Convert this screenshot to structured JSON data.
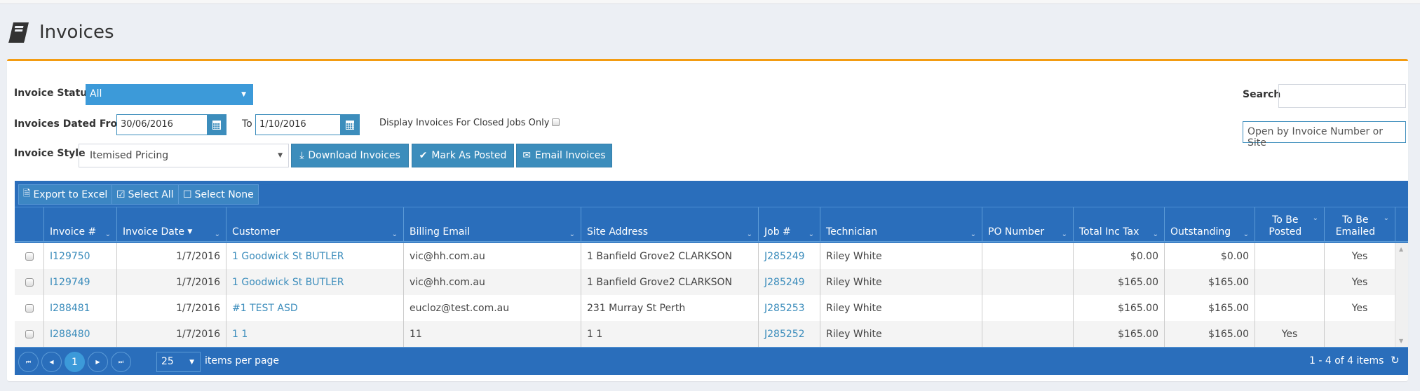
{
  "page": {
    "title": "Invoices",
    "icon": "book-icon"
  },
  "filters": {
    "status_label": "Invoice Status",
    "status_value": "All",
    "dated_from_label": "Invoices Dated From",
    "date_from": "30/06/2016",
    "to_label": "To",
    "date_to": "1/10/2016",
    "closed_jobs_label": "Display Invoices For Closed Jobs Only",
    "style_label": "Invoice Style",
    "style_value": "Itemised Pricing",
    "search_label": "Search",
    "search_value": "",
    "open_placeholder": "Open by Invoice Number or Site"
  },
  "actions": {
    "download": "Download Invoices",
    "mark_posted": "Mark As Posted",
    "email": "Email Invoices"
  },
  "grid_toolbar": {
    "export": "Export to Excel",
    "select_all": "Select All",
    "select_none": "Select None"
  },
  "columns": [
    {
      "key": "invoice",
      "label": "Invoice #"
    },
    {
      "key": "date",
      "label": "Invoice Date",
      "sorted": "desc"
    },
    {
      "key": "customer",
      "label": "Customer"
    },
    {
      "key": "email",
      "label": "Billing Email"
    },
    {
      "key": "site",
      "label": "Site Address"
    },
    {
      "key": "job",
      "label": "Job #"
    },
    {
      "key": "tech",
      "label": "Technician"
    },
    {
      "key": "po",
      "label": "PO Number"
    },
    {
      "key": "total",
      "label": "Total Inc Tax"
    },
    {
      "key": "outstanding",
      "label": "Outstanding"
    },
    {
      "key": "posted",
      "label_line1": "To Be",
      "label_line2": "Posted"
    },
    {
      "key": "emailed",
      "label_line1": "To Be",
      "label_line2": "Emailed"
    }
  ],
  "rows": [
    {
      "invoice": "I129750",
      "date": "1/7/2016",
      "customer": "1 Goodwick St BUTLER",
      "email": "vic@hh.com.au",
      "site": "1 Banfield Grove2 CLARKSON",
      "job": "J285249",
      "tech": "Riley White",
      "po": "",
      "total": "$0.00",
      "outstanding": "$0.00",
      "posted": "",
      "emailed": "Yes"
    },
    {
      "invoice": "I129749",
      "date": "1/7/2016",
      "customer": "1 Goodwick St BUTLER",
      "email": "vic@hh.com.au",
      "site": "1 Banfield Grove2 CLARKSON",
      "job": "J285249",
      "tech": "Riley White",
      "po": "",
      "total": "$165.00",
      "outstanding": "$165.00",
      "posted": "",
      "emailed": "Yes"
    },
    {
      "invoice": "I288481",
      "date": "1/7/2016",
      "customer": "#1 TEST ASD",
      "email": "eucloz@test.com.au",
      "site": "231 Murray St Perth",
      "job": "J285253",
      "tech": "Riley White",
      "po": "",
      "total": "$165.00",
      "outstanding": "$165.00",
      "posted": "",
      "emailed": "Yes"
    },
    {
      "invoice": "I288480",
      "date": "1/7/2016",
      "customer": "1 1",
      "email": "11",
      "site": "1 1",
      "job": "J285252",
      "tech": "Riley White",
      "po": "",
      "total": "$165.00",
      "outstanding": "$165.00",
      "posted": "Yes",
      "emailed": ""
    }
  ],
  "pager": {
    "current_page": "1",
    "page_size": "25",
    "items_per_page_label": "items per page",
    "summary": "1 - 4 of 4 items"
  },
  "colors": {
    "accent": "#3c8dbc",
    "grid_header": "#2a6ebb",
    "card_top": "#f39c12"
  }
}
